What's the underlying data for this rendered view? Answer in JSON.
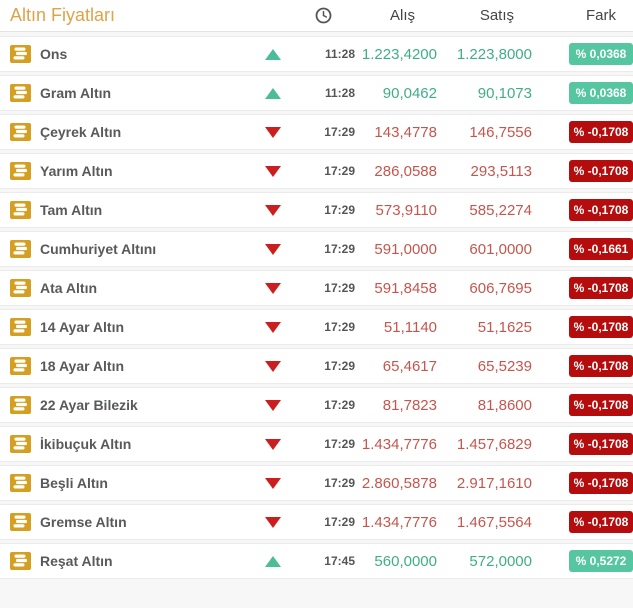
{
  "header": {
    "title": "Altın Fiyatları",
    "columns": {
      "time_icon": "clock-icon",
      "buy": "Alış",
      "sell": "Satış",
      "diff": "Fark"
    }
  },
  "colors": {
    "title": "#dfa348",
    "gold_icon": "#d5a021",
    "up_arrow": "#4cbd98",
    "up_value_text": "#3fae85",
    "up_badge": "#56c6a0",
    "down_arrow": "#cb1f1f",
    "down_value_text": "#c4564e",
    "down_badge": "#b50d0d"
  },
  "rows": [
    {
      "name": "Ons",
      "direction": "up",
      "time": "11:28",
      "buy": "1.223,4200",
      "sell": "1.223,8000",
      "change": "% 0,0368"
    },
    {
      "name": "Gram Altın",
      "direction": "up",
      "time": "11:28",
      "buy": "90,0462",
      "sell": "90,1073",
      "change": "% 0,0368"
    },
    {
      "name": "Çeyrek Altın",
      "direction": "down",
      "time": "17:29",
      "buy": "143,4778",
      "sell": "146,7556",
      "change": "% -0,1708"
    },
    {
      "name": "Yarım Altın",
      "direction": "down",
      "time": "17:29",
      "buy": "286,0588",
      "sell": "293,5113",
      "change": "% -0,1708"
    },
    {
      "name": "Tam Altın",
      "direction": "down",
      "time": "17:29",
      "buy": "573,9110",
      "sell": "585,2274",
      "change": "% -0,1708"
    },
    {
      "name": "Cumhuriyet Altını",
      "direction": "down",
      "time": "17:29",
      "buy": "591,0000",
      "sell": "601,0000",
      "change": "% -0,1661"
    },
    {
      "name": "Ata Altın",
      "direction": "down",
      "time": "17:29",
      "buy": "591,8458",
      "sell": "606,7695",
      "change": "% -0,1708"
    },
    {
      "name": "14 Ayar Altın",
      "direction": "down",
      "time": "17:29",
      "buy": "51,1140",
      "sell": "51,1625",
      "change": "% -0,1708"
    },
    {
      "name": "18 Ayar Altın",
      "direction": "down",
      "time": "17:29",
      "buy": "65,4617",
      "sell": "65,5239",
      "change": "% -0,1708"
    },
    {
      "name": "22 Ayar Bilezik",
      "direction": "down",
      "time": "17:29",
      "buy": "81,7823",
      "sell": "81,8600",
      "change": "% -0,1708"
    },
    {
      "name": "İkibuçuk Altın",
      "direction": "down",
      "time": "17:29",
      "buy": "1.434,7776",
      "sell": "1.457,6829",
      "change": "% -0,1708"
    },
    {
      "name": "Beşli Altın",
      "direction": "down",
      "time": "17:29",
      "buy": "2.860,5878",
      "sell": "2.917,1610",
      "change": "% -0,1708"
    },
    {
      "name": "Gremse Altın",
      "direction": "down",
      "time": "17:29",
      "buy": "1.434,7776",
      "sell": "1.467,5564",
      "change": "% -0,1708"
    },
    {
      "name": "Reşat Altın",
      "direction": "up",
      "time": "17:45",
      "buy": "560,0000",
      "sell": "572,0000",
      "change": "% 0,5272"
    }
  ]
}
